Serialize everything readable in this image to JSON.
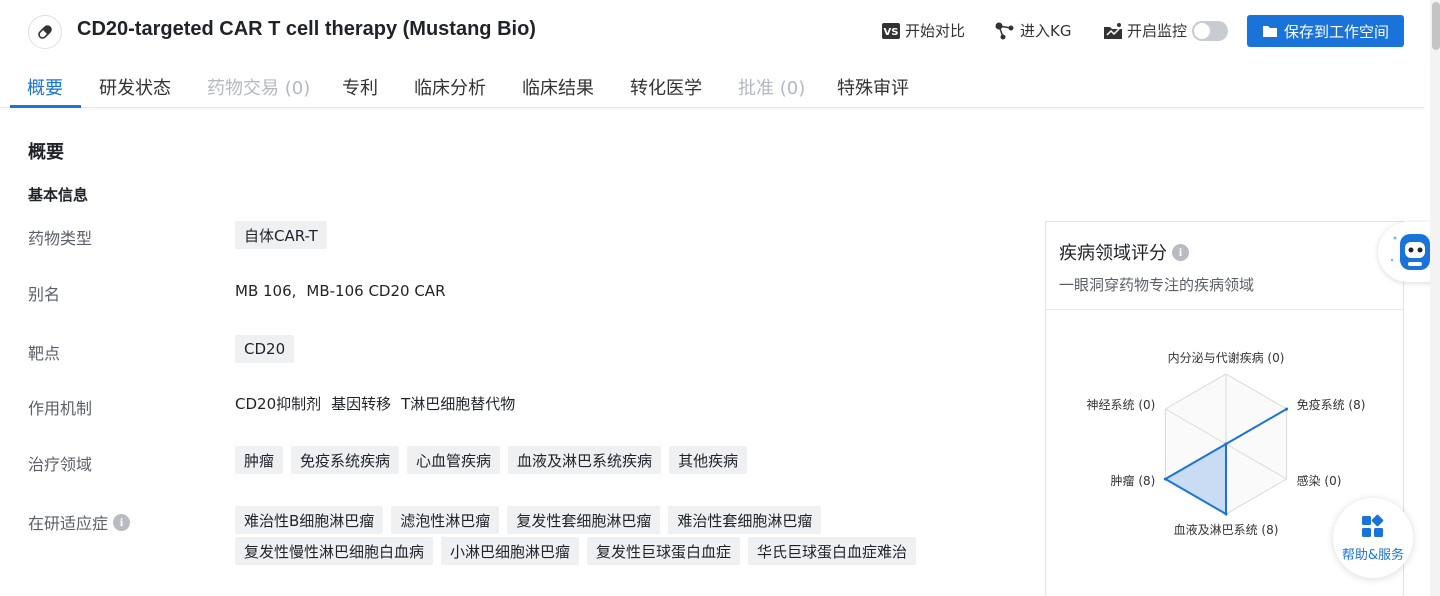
{
  "header": {
    "title": "CD20-targeted CAR T cell therapy (Mustang Bio)",
    "compare_label": "开始对比",
    "kg_label": "进入KG",
    "monitor_label": "开启监控",
    "save_label": "保存到工作空间",
    "accent_color": "#1a73d9"
  },
  "tabs": [
    {
      "label": "概要",
      "state": "active"
    },
    {
      "label": "研发状态",
      "state": "normal"
    },
    {
      "label": "药物交易 (0)",
      "state": "disabled"
    },
    {
      "label": "专利",
      "state": "normal"
    },
    {
      "label": "临床分析",
      "state": "normal"
    },
    {
      "label": "临床结果",
      "state": "normal"
    },
    {
      "label": "转化医学",
      "state": "normal"
    },
    {
      "label": "批准 (0)",
      "state": "disabled"
    },
    {
      "label": "特殊审评",
      "state": "normal"
    }
  ],
  "section": {
    "title": "概要",
    "subtitle": "基本信息"
  },
  "fields": {
    "drug_type": {
      "label": "药物类型",
      "tags": [
        "自体CAR-T"
      ]
    },
    "aliases": {
      "label": "别名",
      "values": [
        "MB 106,",
        "MB-106 CD20 CAR"
      ]
    },
    "target": {
      "label": "靶点",
      "tags": [
        "CD20"
      ]
    },
    "mechanism": {
      "label": "作用机制",
      "values": [
        "CD20抑制剂",
        "基因转移",
        "T淋巴细胞替代物"
      ]
    },
    "therapeutic_area": {
      "label": "治疗领域",
      "tags": [
        "肿瘤",
        "免疫系统疾病",
        "心血管疾病",
        "血液及淋巴系统疾病",
        "其他疾病"
      ]
    },
    "indications": {
      "label": "在研适应症",
      "tags_row1": [
        "难治性B细胞淋巴瘤",
        "滤泡性淋巴瘤",
        "复发性套细胞淋巴瘤",
        "难治性套细胞淋巴瘤"
      ],
      "tags_row2": [
        "复发性慢性淋巴细胞白血病",
        "小淋巴细胞淋巴瘤",
        "复发性巨球蛋白血症",
        "华氏巨球蛋白血症难治"
      ]
    }
  },
  "panel": {
    "title": "疾病领域评分",
    "subtitle": "一眼洞穿药物专注的疾病领域"
  },
  "chart_data": {
    "type": "radar",
    "axes": [
      "内分泌与代谢疾病",
      "免疫系统",
      "感染",
      "血液及淋巴系统",
      "肿瘤",
      "神经系统"
    ],
    "axis_labels": [
      "内分泌与代谢疾病 (0)",
      "免疫系统 (8)",
      "感染 (0)",
      "血液及淋巴系统 (8)",
      "肿瘤 (8)",
      "神经系统 (0)"
    ],
    "values": [
      0,
      8,
      0,
      8,
      8,
      0
    ],
    "max": 8,
    "color": "#1a73d9"
  },
  "help": {
    "label": "帮助&服务"
  }
}
